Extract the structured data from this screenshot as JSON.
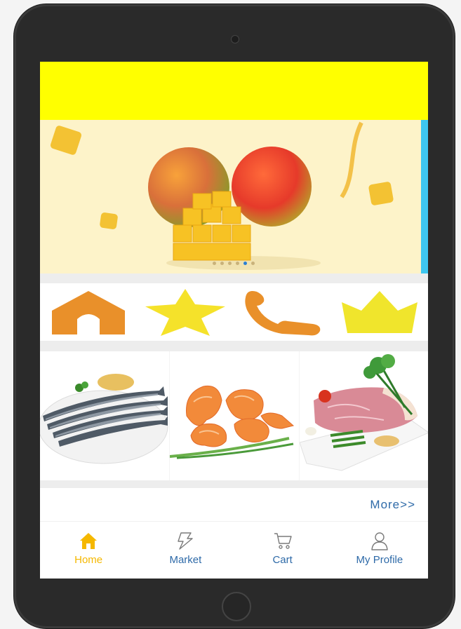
{
  "banner": {
    "dots_count": 6,
    "active_dot": 4
  },
  "quick_icons": [
    {
      "name": "home-icon",
      "color": "#e9902a"
    },
    {
      "name": "star-icon",
      "color": "#f5e22a"
    },
    {
      "name": "phone-icon",
      "color": "#e9902a"
    },
    {
      "name": "crown-icon",
      "color": "#f0e52c"
    }
  ],
  "products": [
    {
      "name": "fish-image"
    },
    {
      "name": "shrimp-image"
    },
    {
      "name": "meat-image"
    }
  ],
  "more_label": "More>>",
  "tabbar": {
    "tabs": [
      {
        "label": "Home",
        "icon": "house-icon",
        "active": true
      },
      {
        "label": "Market",
        "icon": "lightning-icon",
        "active": false
      },
      {
        "label": "Cart",
        "icon": "cart-icon",
        "active": false
      },
      {
        "label": "My Profile",
        "icon": "user-icon",
        "active": false
      }
    ]
  },
  "colors": {
    "top_bar": "#ffff00",
    "accent_active": "#f5b800",
    "tab_text": "#2e6aa8",
    "banner_bg": "#fdf3c9"
  }
}
